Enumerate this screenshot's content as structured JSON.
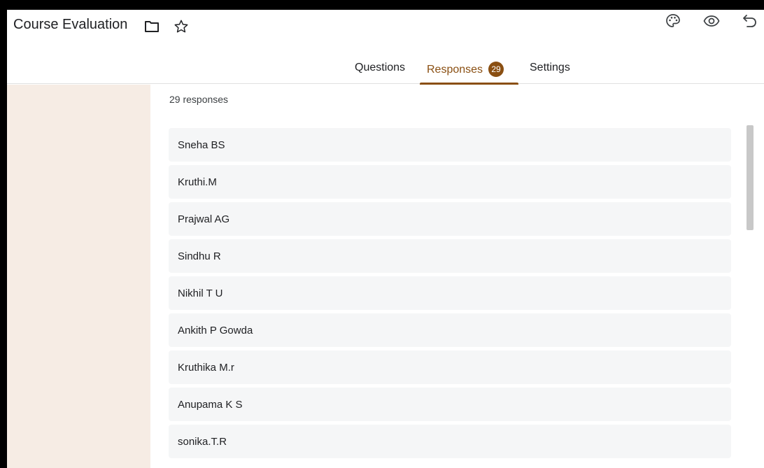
{
  "header": {
    "title": "Course Evaluation",
    "icons": [
      "folder-icon",
      "star-icon",
      "palette-icon",
      "eye-icon",
      "undo-icon"
    ]
  },
  "tabs": {
    "questions": "Questions",
    "responses": "Responses",
    "responses_badge": "29",
    "settings": "Settings",
    "active": "responses"
  },
  "main": {
    "count_label": "29 responses",
    "responses": [
      "Sneha BS",
      "Kruthi.M",
      "Prajwal AG",
      "Sindhu R",
      "Nikhil T U",
      "Ankith P Gowda",
      "Kruthika M.r",
      "Anupama K S",
      "sonika.T.R"
    ]
  },
  "colors": {
    "accent": "#8a4f12",
    "side_panel": "#f6ece4",
    "row_bg": "#f5f6f7"
  }
}
